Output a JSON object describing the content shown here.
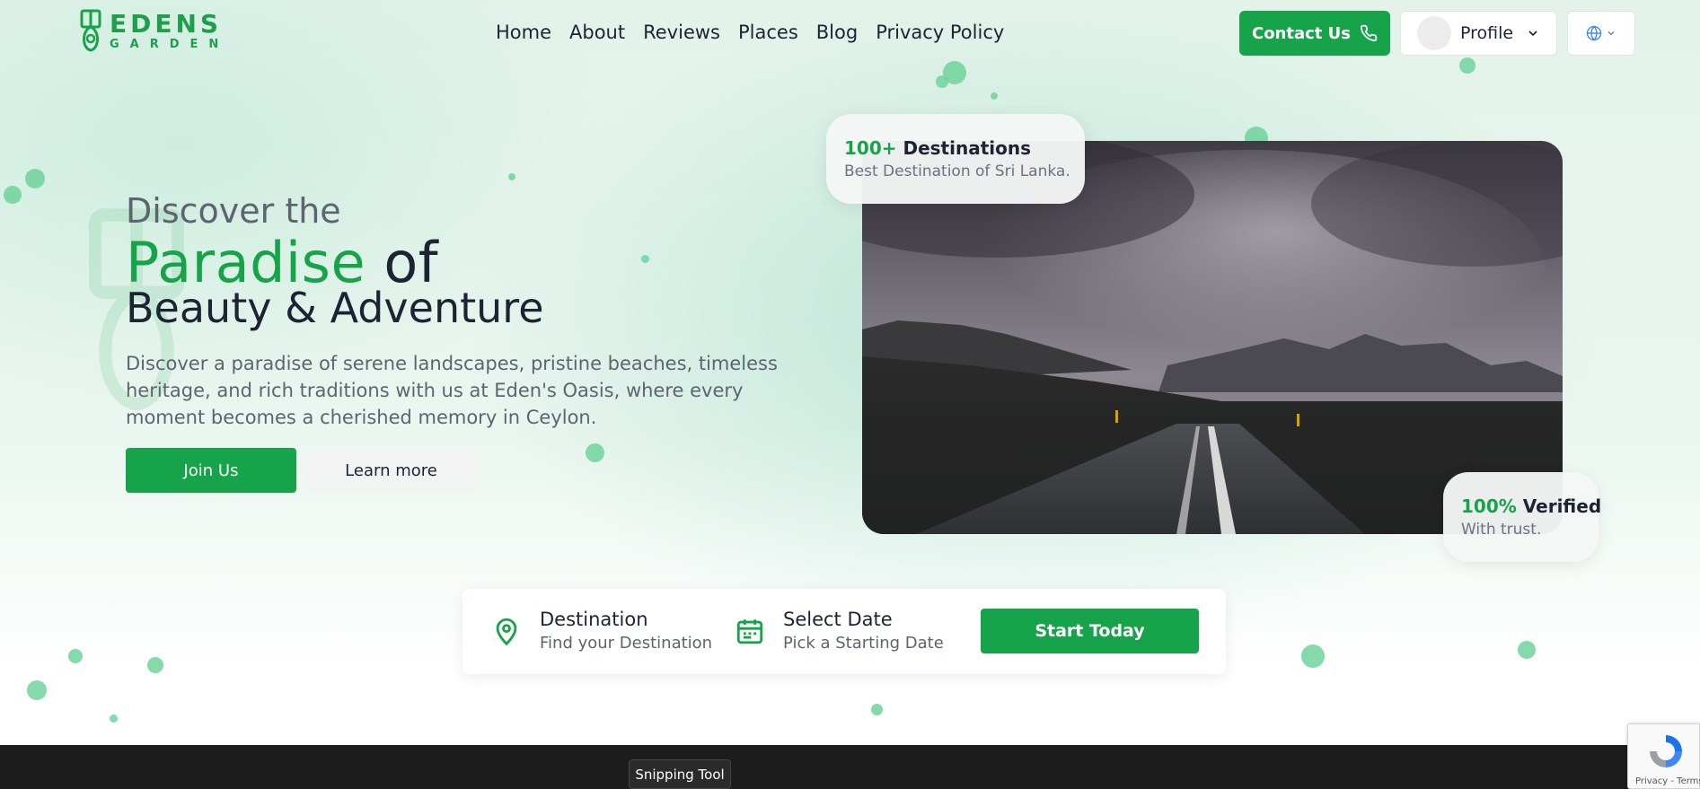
{
  "brand": {
    "line1": "EDENS",
    "line2": "GARDEN",
    "color": "#16a34a"
  },
  "nav": [
    "Home",
    "About",
    "Reviews",
    "Places",
    "Blog",
    "Privacy Policy"
  ],
  "header": {
    "contact_label": "Contact Us",
    "contact_icon": "phone-icon",
    "profile_label": "Profile",
    "profile_icon": "chevron-down-icon",
    "language_icon": "globe-icon"
  },
  "hero": {
    "pre": "Discover the",
    "title_highlight": "Paradise",
    "title_rest": "of",
    "subtitle": "Beauty & Adventure",
    "description": "Discover a paradise of serene landscapes, pristine beaches, timeless heritage, and rich traditions with us at Eden's Oasis, where every moment becomes a cherished memory in Ceylon.",
    "join_label": "Join Us",
    "learn_label": "Learn more"
  },
  "stats": {
    "destinations_value": "100+",
    "destinations_label": "Destinations",
    "destinations_sub": "Best Destination of Sri Lanka.",
    "verified_value": "100%",
    "verified_label": "Verified",
    "verified_sub": "With trust."
  },
  "search": {
    "destination_title": "Destination",
    "destination_sub": "Find your Destination",
    "destination_icon": "map-pin-icon",
    "date_title": "Select Date",
    "date_sub": "Pick a Starting Date",
    "date_icon": "calendar-icon",
    "start_label": "Start Today"
  },
  "taskbar": {
    "tooltip": "Snipping Tool"
  },
  "recaptcha": {
    "text": "Privacy - Terms"
  },
  "colors": {
    "accent": "#16a34a",
    "text_dark": "#1c2433",
    "text_muted": "#5d6470"
  }
}
